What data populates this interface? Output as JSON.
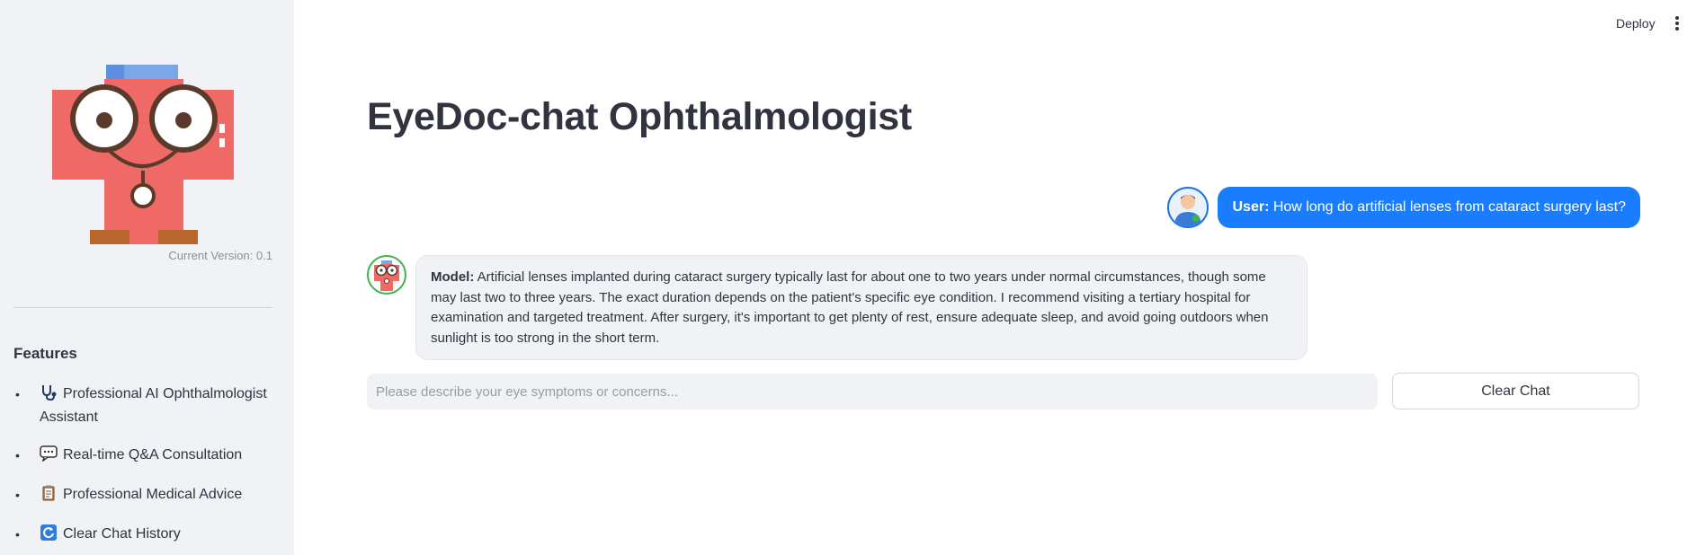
{
  "header": {
    "deploy_label": "Deploy"
  },
  "sidebar": {
    "version": "Current Version: 0.1",
    "features_title": "Features",
    "features": [
      {
        "icon": "stethoscope-icon",
        "label": "Professional AI Ophthalmologist Assistant"
      },
      {
        "icon": "speech-bubble-icon",
        "label": "Real-time Q&A Consultation"
      },
      {
        "icon": "clipboard-icon",
        "label": "Professional Medical Advice"
      },
      {
        "icon": "refresh-icon",
        "label": "Clear Chat History"
      }
    ]
  },
  "main": {
    "title": "EyeDoc-chat Ophthalmologist",
    "messages": [
      {
        "role": "user",
        "prefix": "User:",
        "text": " How long do artificial lenses from cataract surgery last?"
      },
      {
        "role": "model",
        "prefix": "Model:",
        "text": " Artificial lenses implanted during cataract surgery typically last for about one to two years under normal circumstances, though some may last two to three years. The exact duration depends on the patient's specific eye condition. I recommend visiting a tertiary hospital for examination and targeted treatment. After surgery, it's important to get plenty of rest, ensure adequate sleep, and avoid going outdoors when sunlight is too strong in the short term."
      }
    ],
    "input_placeholder": "Please describe your eye symptoms or concerns...",
    "input_value": "",
    "clear_button_label": "Clear Chat"
  },
  "colors": {
    "sidebar_bg": "#f0f2f6",
    "user_bubble": "#1a7dff",
    "model_bubble": "#f0f2f6",
    "text": "#31333f"
  }
}
